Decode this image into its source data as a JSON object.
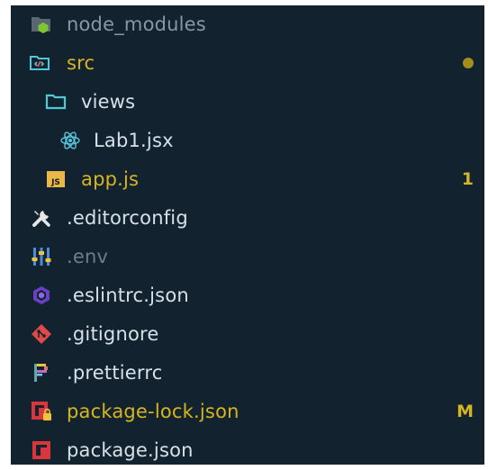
{
  "explorer": {
    "items": [
      {
        "name": "node_modules",
        "icon": "node-folder-icon",
        "color": "#8a97a3",
        "depth": 0
      },
      {
        "name": "src",
        "icon": "src-folder-icon",
        "color": "#d7b521",
        "depth": 0,
        "modified_dot": true
      },
      {
        "name": "views",
        "icon": "folder-icon",
        "color": "#d8e0e7",
        "depth": 1
      },
      {
        "name": "Lab1.jsx",
        "icon": "react-icon",
        "color": "#d8e0e7",
        "depth": 2
      },
      {
        "name": "app.js",
        "icon": "js-icon",
        "color": "#d7b521",
        "depth": 1,
        "badge": "1"
      },
      {
        "name": ".editorconfig",
        "icon": "tools-icon",
        "color": "#d8e0e7",
        "depth": 0
      },
      {
        "name": ".env",
        "icon": "env-icon",
        "color": "#6f7d89",
        "depth": 0
      },
      {
        "name": ".eslintrc.json",
        "icon": "eslint-icon",
        "color": "#d8e0e7",
        "depth": 0
      },
      {
        "name": ".gitignore",
        "icon": "git-icon",
        "color": "#d8e0e7",
        "depth": 0
      },
      {
        "name": ".prettierrc",
        "icon": "prettier-icon",
        "color": "#d8e0e7",
        "depth": 0
      },
      {
        "name": "package-lock.json",
        "icon": "npm-lock-icon",
        "color": "#d7b521",
        "depth": 0,
        "badge": "M"
      },
      {
        "name": "package.json",
        "icon": "npm-icon",
        "color": "#d8e0e7",
        "depth": 0
      }
    ]
  },
  "colors": {
    "background": "#12232f",
    "modified": "#d7b521",
    "dot": "#a58d1d"
  }
}
